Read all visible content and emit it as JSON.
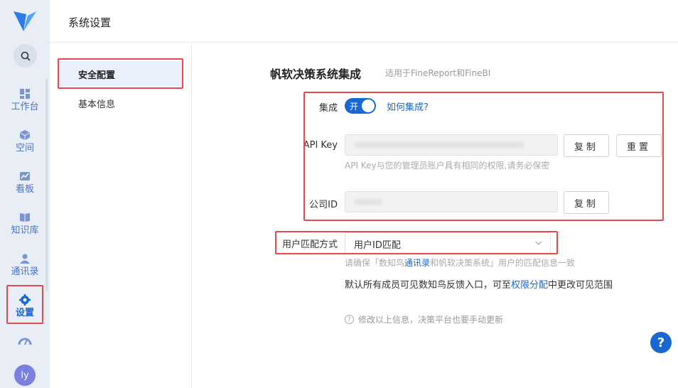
{
  "header": {
    "title": "系统设置"
  },
  "rail": {
    "items": [
      {
        "label": "工作台",
        "icon": "dashboard-icon"
      },
      {
        "label": "空间",
        "icon": "cube-icon"
      },
      {
        "label": "看板",
        "icon": "board-icon"
      },
      {
        "label": "知识库",
        "icon": "book-icon"
      },
      {
        "label": "通讯录",
        "icon": "contacts-icon"
      },
      {
        "label": "设置",
        "icon": "gear-icon"
      }
    ],
    "avatar": "ly"
  },
  "subnav": {
    "items": [
      {
        "label": "安全配置"
      },
      {
        "label": "基本信息"
      }
    ]
  },
  "section": {
    "title": "帆软决策系统集成",
    "subtitle": "适用于FineReport和FineBI",
    "integration_label": "集成",
    "toggle_text": "开",
    "how_link": "如何集成?",
    "api_key_label": "API Key",
    "api_key_hint": "API Key与您的管理员账户具有相同的权限,请务必保密",
    "copy_label": "复制",
    "reset_label": "重置",
    "company_id_label": "公司ID",
    "match_label": "用户匹配方式",
    "match_value": "用户ID匹配",
    "match_hint_pre": "请确保「数知鸟",
    "match_hint_link": "通讯录",
    "match_hint_post": "和帆软决策系统」用户的匹配信息一致",
    "note_pre": "默认所有成员可见数知鸟反馈入口，可至",
    "note_link": "权限分配",
    "note_post": "中更改可见范围",
    "tip": "修改以上信息，决策平台也要手动更新"
  },
  "help": "?"
}
